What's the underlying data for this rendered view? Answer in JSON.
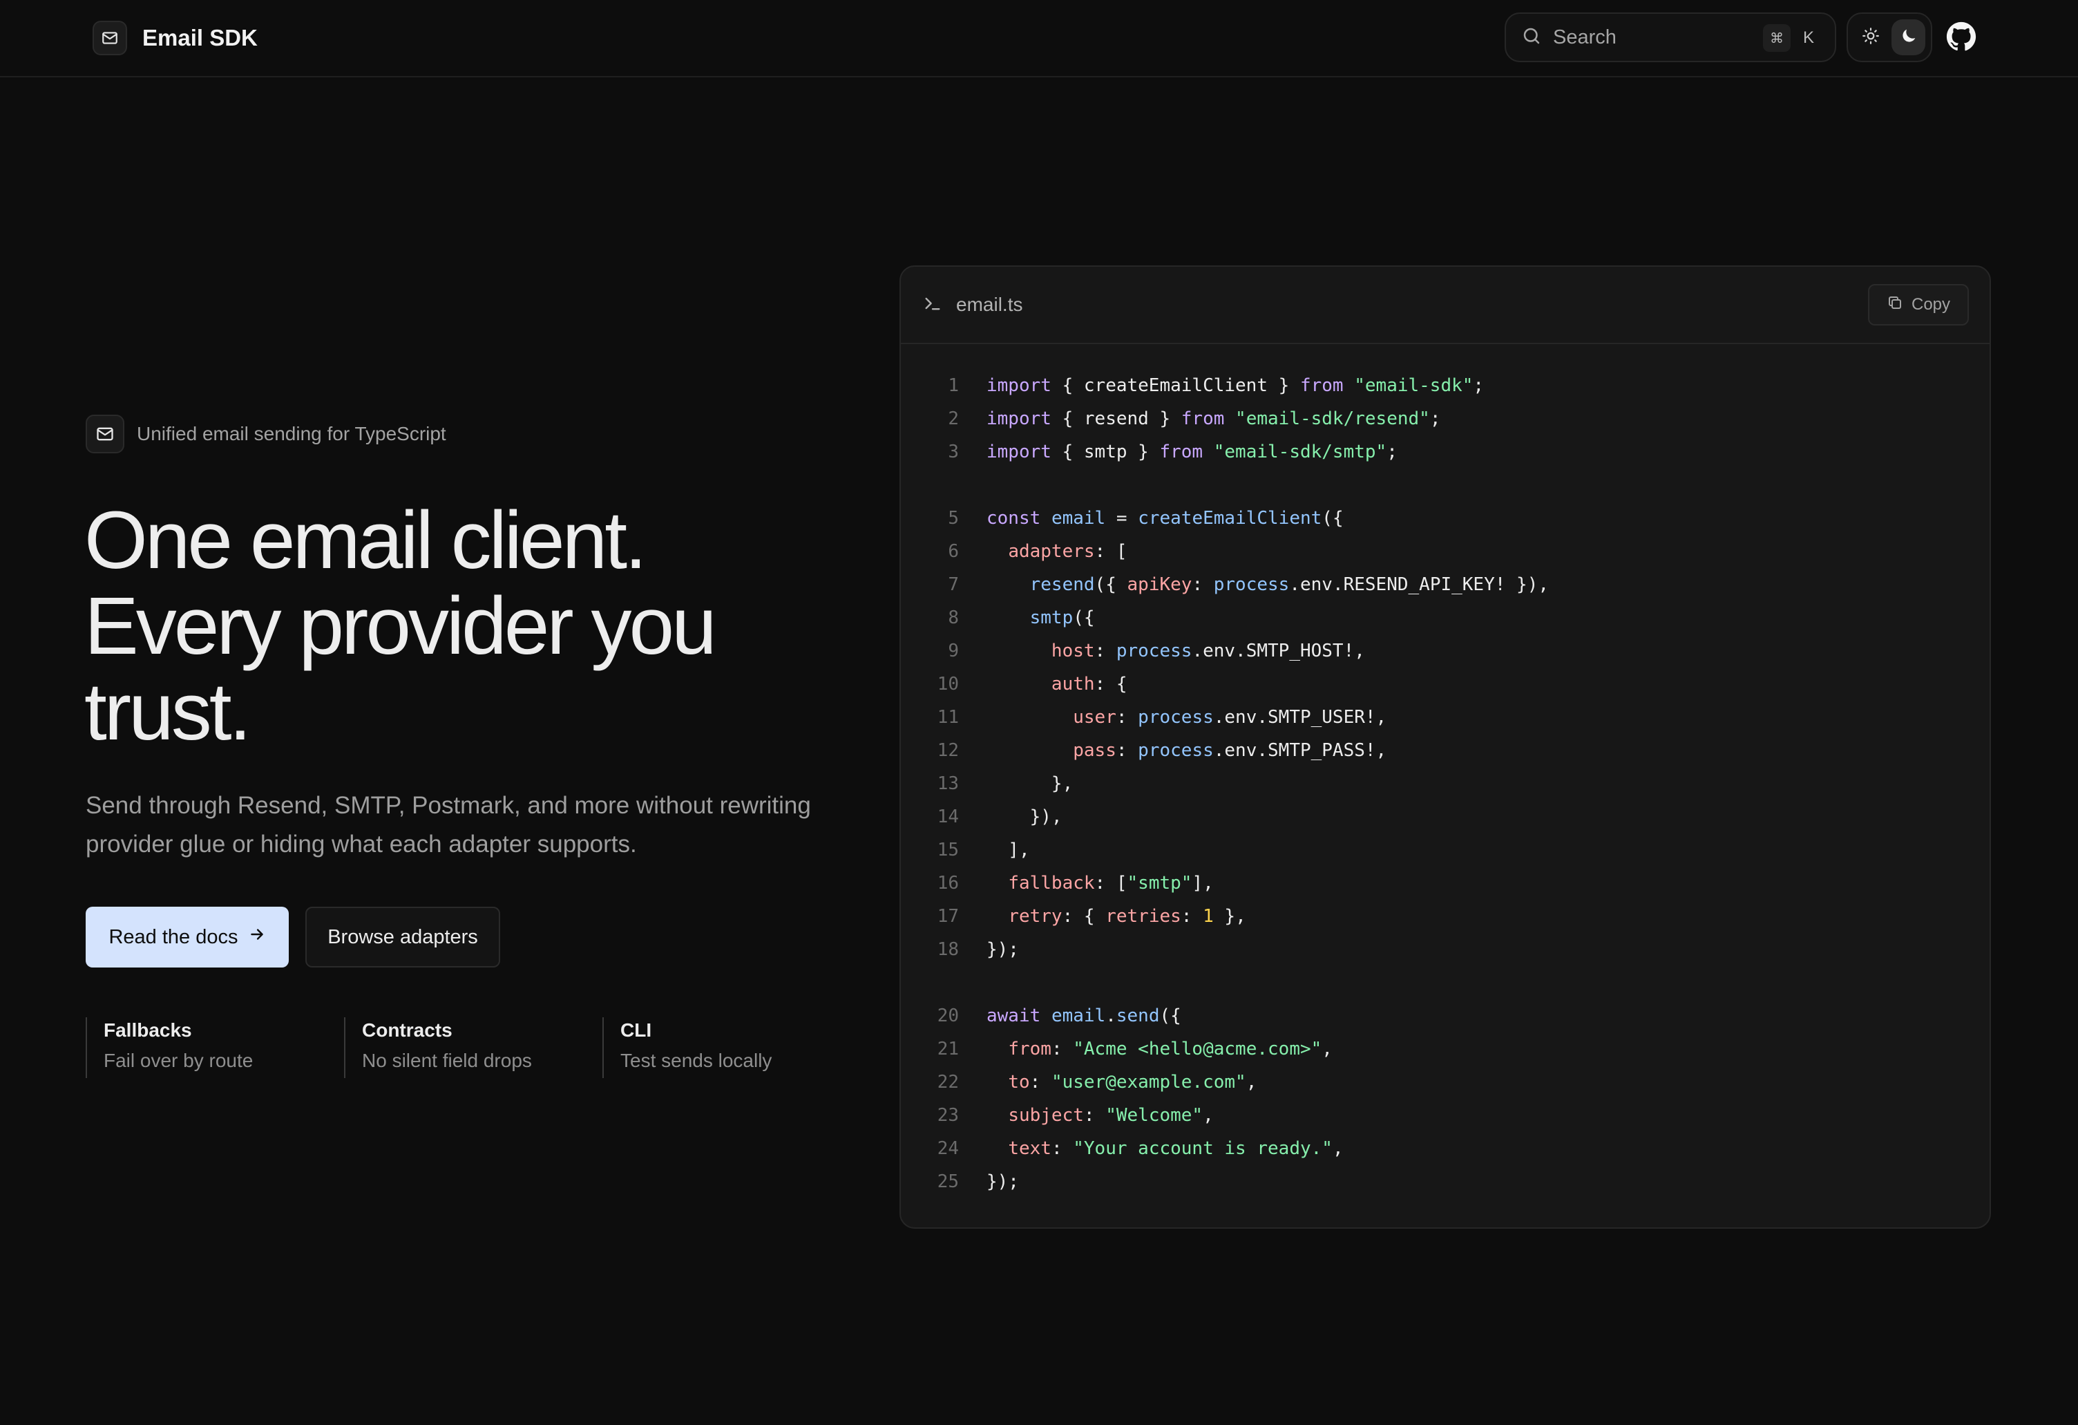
{
  "header": {
    "brand": "Email SDK",
    "search_placeholder": "Search",
    "kbd_cmd": "⌘",
    "kbd_k": "K"
  },
  "hero": {
    "tagline": "Unified email sending for TypeScript",
    "headline": [
      "One email client.",
      "Every provider you",
      "trust."
    ],
    "lead": "Send through Resend, SMTP, Postmark, and more without rewriting provider glue or hiding what each adapter supports.",
    "primary_cta": "Read the docs",
    "secondary_cta": "Browse adapters",
    "features": [
      {
        "title": "Fallbacks",
        "subtitle": "Fail over by route"
      },
      {
        "title": "Contracts",
        "subtitle": "No silent field drops"
      },
      {
        "title": "CLI",
        "subtitle": "Test sends locally"
      }
    ]
  },
  "code": {
    "file_name": "email.ts",
    "copy_label": "Copy",
    "lines": [
      {
        "n": "1",
        "t": [
          [
            "kw",
            "import"
          ],
          [
            "pl",
            " { createEmailClient } "
          ],
          [
            "kw",
            "from"
          ],
          [
            "pl",
            " "
          ],
          [
            "str",
            "\"email-sdk\""
          ],
          [
            "pl",
            ";"
          ]
        ]
      },
      {
        "n": "2",
        "t": [
          [
            "kw",
            "import"
          ],
          [
            "pl",
            " { resend } "
          ],
          [
            "kw",
            "from"
          ],
          [
            "pl",
            " "
          ],
          [
            "str",
            "\"email-sdk/resend\""
          ],
          [
            "pl",
            ";"
          ]
        ]
      },
      {
        "n": "3",
        "t": [
          [
            "kw",
            "import"
          ],
          [
            "pl",
            " { smtp } "
          ],
          [
            "kw",
            "from"
          ],
          [
            "pl",
            " "
          ],
          [
            "str",
            "\"email-sdk/smtp\""
          ],
          [
            "pl",
            ";"
          ]
        ]
      },
      {
        "n": "",
        "t": []
      },
      {
        "n": "5",
        "t": [
          [
            "kw",
            "const"
          ],
          [
            "pl",
            " "
          ],
          [
            "fn",
            "email"
          ],
          [
            "pl",
            " = "
          ],
          [
            "fn",
            "createEmailClient"
          ],
          [
            "pl",
            "({"
          ]
        ]
      },
      {
        "n": "6",
        "t": [
          [
            "pl",
            "  "
          ],
          [
            "prop",
            "adapters"
          ],
          [
            "pl",
            ": ["
          ]
        ]
      },
      {
        "n": "7",
        "t": [
          [
            "pl",
            "    "
          ],
          [
            "fn",
            "resend"
          ],
          [
            "pl",
            "({ "
          ],
          [
            "prop",
            "apiKey"
          ],
          [
            "pl",
            ": "
          ],
          [
            "fn",
            "process"
          ],
          [
            "pl",
            ".env.RESEND_API_KEY! }),"
          ]
        ]
      },
      {
        "n": "8",
        "t": [
          [
            "pl",
            "    "
          ],
          [
            "fn",
            "smtp"
          ],
          [
            "pl",
            "({"
          ]
        ]
      },
      {
        "n": "9",
        "t": [
          [
            "pl",
            "      "
          ],
          [
            "prop",
            "host"
          ],
          [
            "pl",
            ": "
          ],
          [
            "fn",
            "process"
          ],
          [
            "pl",
            ".env.SMTP_HOST!,"
          ]
        ]
      },
      {
        "n": "10",
        "t": [
          [
            "pl",
            "      "
          ],
          [
            "prop",
            "auth"
          ],
          [
            "pl",
            ": {"
          ]
        ]
      },
      {
        "n": "11",
        "t": [
          [
            "pl",
            "        "
          ],
          [
            "prop",
            "user"
          ],
          [
            "pl",
            ": "
          ],
          [
            "fn",
            "process"
          ],
          [
            "pl",
            ".env.SMTP_USER!,"
          ]
        ]
      },
      {
        "n": "12",
        "t": [
          [
            "pl",
            "        "
          ],
          [
            "prop",
            "pass"
          ],
          [
            "pl",
            ": "
          ],
          [
            "fn",
            "process"
          ],
          [
            "pl",
            ".env.SMTP_PASS!,"
          ]
        ]
      },
      {
        "n": "13",
        "t": [
          [
            "pl",
            "      },"
          ]
        ]
      },
      {
        "n": "14",
        "t": [
          [
            "pl",
            "    }),"
          ]
        ]
      },
      {
        "n": "15",
        "t": [
          [
            "pl",
            "  ],"
          ]
        ]
      },
      {
        "n": "16",
        "t": [
          [
            "pl",
            "  "
          ],
          [
            "prop",
            "fallback"
          ],
          [
            "pl",
            ": ["
          ],
          [
            "str",
            "\"smtp\""
          ],
          [
            "pl",
            "],"
          ]
        ]
      },
      {
        "n": "17",
        "t": [
          [
            "pl",
            "  "
          ],
          [
            "prop",
            "retry"
          ],
          [
            "pl",
            ": { "
          ],
          [
            "prop",
            "retries"
          ],
          [
            "pl",
            ": "
          ],
          [
            "num",
            "1"
          ],
          [
            "pl",
            " },"
          ]
        ]
      },
      {
        "n": "18",
        "t": [
          [
            "pl",
            "});"
          ]
        ]
      },
      {
        "n": "",
        "t": []
      },
      {
        "n": "20",
        "t": [
          [
            "kw",
            "await"
          ],
          [
            "pl",
            " "
          ],
          [
            "fn",
            "email"
          ],
          [
            "pl",
            "."
          ],
          [
            "fn",
            "send"
          ],
          [
            "pl",
            "({"
          ]
        ]
      },
      {
        "n": "21",
        "t": [
          [
            "pl",
            "  "
          ],
          [
            "prop",
            "from"
          ],
          [
            "pl",
            ": "
          ],
          [
            "str",
            "\"Acme <hello@acme.com>\""
          ],
          [
            "pl",
            ","
          ]
        ]
      },
      {
        "n": "22",
        "t": [
          [
            "pl",
            "  "
          ],
          [
            "prop",
            "to"
          ],
          [
            "pl",
            ": "
          ],
          [
            "str",
            "\"user@example.com\""
          ],
          [
            "pl",
            ","
          ]
        ]
      },
      {
        "n": "23",
        "t": [
          [
            "pl",
            "  "
          ],
          [
            "prop",
            "subject"
          ],
          [
            "pl",
            ": "
          ],
          [
            "str",
            "\"Welcome\""
          ],
          [
            "pl",
            ","
          ]
        ]
      },
      {
        "n": "24",
        "t": [
          [
            "pl",
            "  "
          ],
          [
            "prop",
            "text"
          ],
          [
            "pl",
            ": "
          ],
          [
            "str",
            "\"Your account is ready.\""
          ],
          [
            "pl",
            ","
          ]
        ]
      },
      {
        "n": "25",
        "t": [
          [
            "pl",
            "});"
          ]
        ]
      }
    ]
  },
  "colors": {
    "background": "#0d0d0d",
    "primary_button": "#d4e3fd",
    "keyword": "#c9a8ff",
    "string": "#86efac",
    "function": "#93c5fd",
    "property": "#fca5a5",
    "number": "#fcd34d"
  },
  "icons": [
    "mail-icon",
    "search-icon",
    "sun-icon",
    "moon-icon",
    "github-icon",
    "terminal-icon",
    "copy-icon",
    "arrow-right-icon"
  ]
}
